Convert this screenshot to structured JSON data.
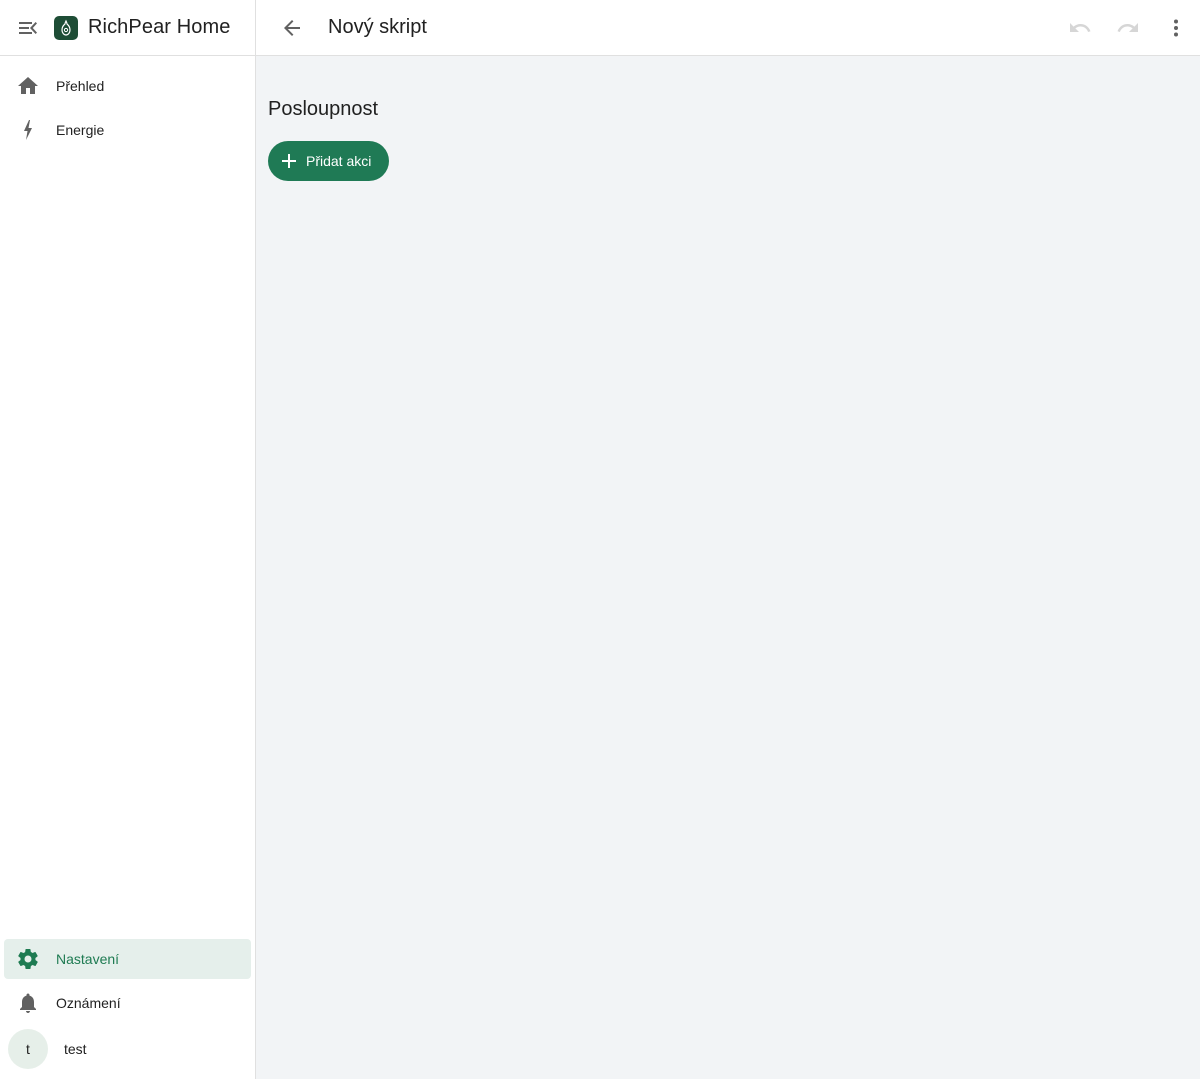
{
  "app": {
    "title": "RichPear Home"
  },
  "sidebar": {
    "items": [
      {
        "label": "Přehled",
        "icon": "home-icon"
      },
      {
        "label": "Energie",
        "icon": "lightning-icon"
      }
    ],
    "bottom_items": [
      {
        "label": "Nastavení",
        "icon": "gear-icon",
        "active": true
      },
      {
        "label": "Oznámení",
        "icon": "bell-icon"
      }
    ],
    "user": {
      "initial": "t",
      "name": "test"
    }
  },
  "header": {
    "title": "Nový skript"
  },
  "main": {
    "section_title": "Posloupnost",
    "add_action_label": "Přidat akci"
  },
  "colors": {
    "accent": "#1f7a55",
    "active_bg": "#e5efeb",
    "active_text": "#1e7b52",
    "logo_bg": "#1e4d36",
    "content_bg": "#f2f4f6"
  }
}
